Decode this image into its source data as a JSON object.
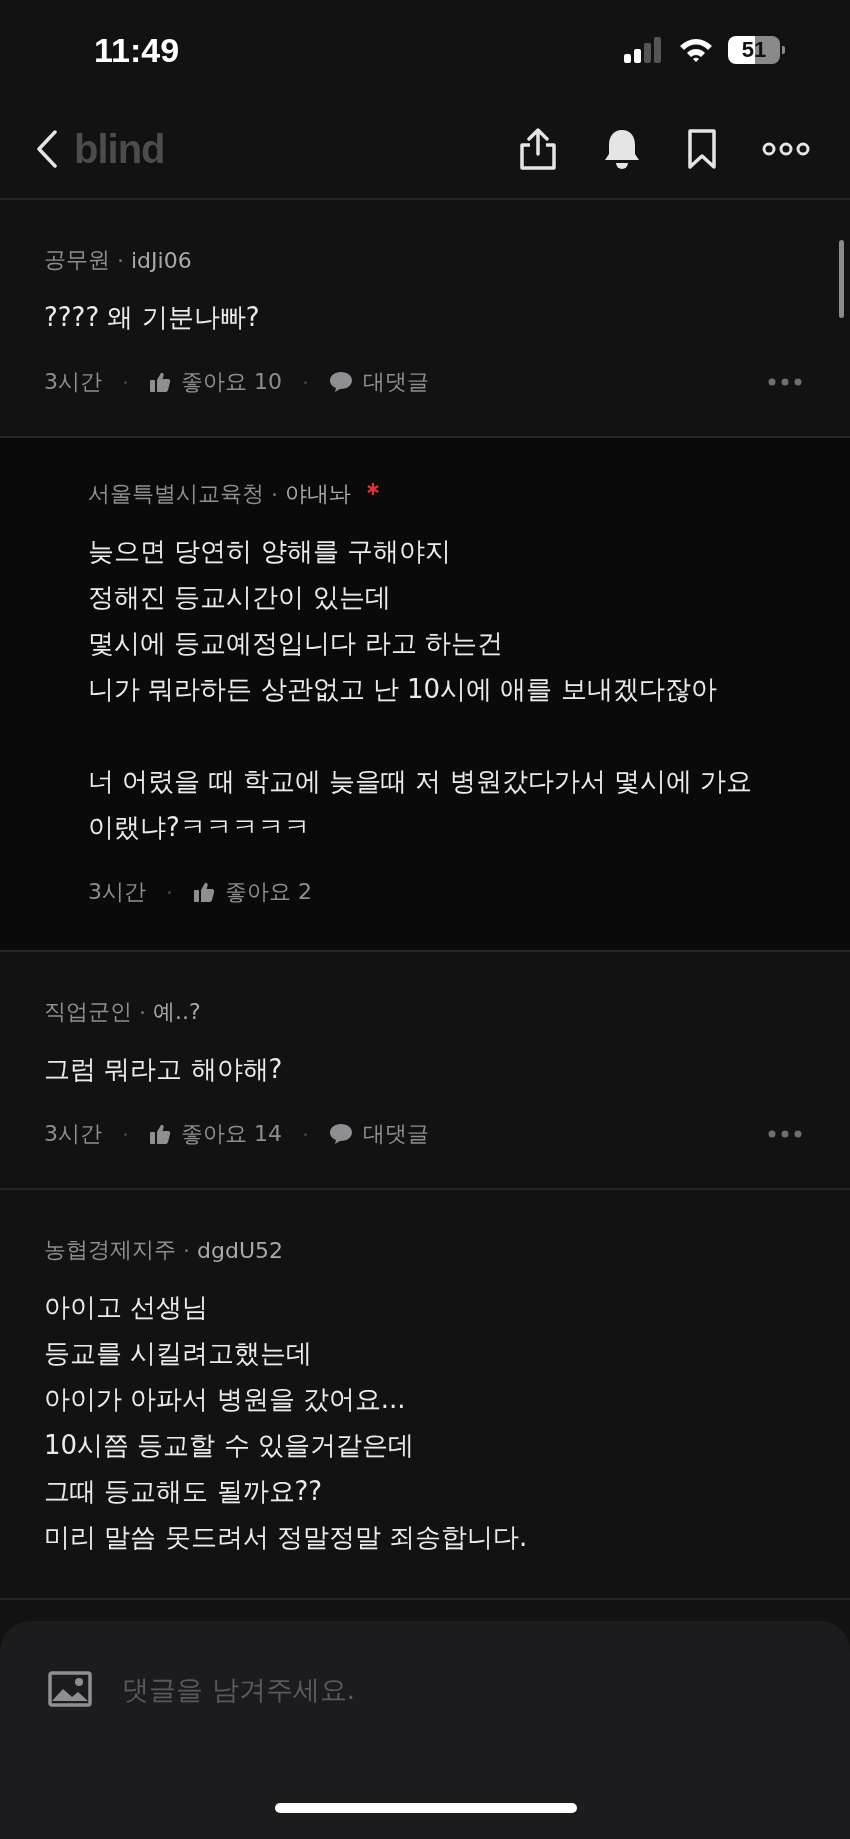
{
  "status_bar": {
    "time": "11:49",
    "battery": "51"
  },
  "nav": {
    "logo": "blind"
  },
  "comments": [
    {
      "kind": "comment",
      "department": "공무원",
      "nickname": "idJi06",
      "is_author": false,
      "paragraphs": [
        [
          "???? 왜 기분나빠?"
        ]
      ],
      "time": "3시간",
      "likes": "좋아요 10",
      "reply_label": "대댓글"
    },
    {
      "kind": "reply",
      "department": "서울특별시교육청",
      "nickname": "야내놔",
      "is_author": true,
      "paragraphs": [
        [
          "늦으면 당연히 양해를 구해야지",
          "정해진 등교시간이 있는데",
          "몇시에 등교예정입니다 라고 하는건",
          "니가 뭐라하든 상관없고 난 10시에 애를 보내겠다잖아"
        ],
        [
          "너 어렸을 때 학교에 늦을때 저 병원갔다가서 몇시에 가요 이랬냐?ㅋㅋㅋㅋㅋ"
        ]
      ],
      "time": "3시간",
      "likes": "좋아요 2"
    },
    {
      "kind": "comment",
      "department": "직업군인",
      "nickname": "예..?",
      "is_author": false,
      "paragraphs": [
        [
          "그럼 뭐라고 해야해?"
        ]
      ],
      "time": "3시간",
      "likes": "좋아요 14",
      "reply_label": "대댓글"
    },
    {
      "kind": "comment",
      "department": "농협경제지주",
      "nickname": "dgdU52",
      "is_author": false,
      "paragraphs": [
        [
          "아이고 선생님",
          "등교를 시킬려고했는데",
          "아이가 아파서 병원을 갔어요...",
          "10시쯤 등교할 수 있을거같은데",
          "그때 등교해도 될까요??",
          "미리 말씀 못드려서 정말정말 죄송합니다."
        ]
      ]
    }
  ],
  "composer": {
    "placeholder": "댓글을 남겨주세요."
  }
}
